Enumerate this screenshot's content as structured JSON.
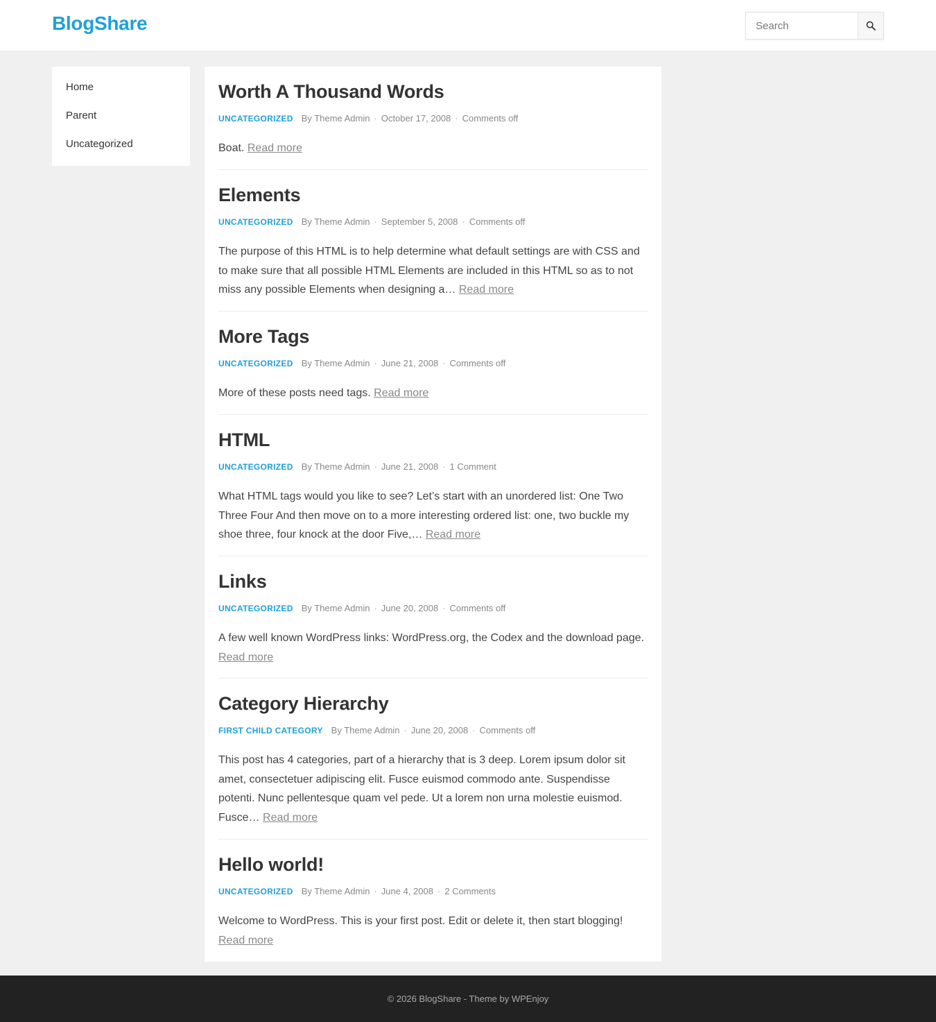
{
  "site": {
    "title": "BlogShare"
  },
  "search": {
    "placeholder": "Search"
  },
  "sidebar": {
    "items": [
      {
        "label": "Home"
      },
      {
        "label": "Parent"
      },
      {
        "label": "Uncategorized"
      }
    ]
  },
  "posts": [
    {
      "title": "Worth A Thousand Words",
      "category": "Uncategorized",
      "author": "By Theme Admin",
      "date": "October 17, 2008",
      "comments": "Comments off",
      "excerpt": "Boat.",
      "read_more": "Read more"
    },
    {
      "title": "Elements",
      "category": "Uncategorized",
      "author": "By Theme Admin",
      "date": "September 5, 2008",
      "comments": "Comments off",
      "excerpt": "The purpose of this HTML is to help determine what default settings are with CSS and to make sure that all possible HTML Elements are included in this HTML so as to not miss any possible Elements when designing a…",
      "read_more": "Read more"
    },
    {
      "title": "More Tags",
      "category": "Uncategorized",
      "author": "By Theme Admin",
      "date": "June 21, 2008",
      "comments": "Comments off",
      "excerpt": "More of these posts need tags.",
      "read_more": "Read more"
    },
    {
      "title": "HTML",
      "category": "Uncategorized",
      "author": "By Theme Admin",
      "date": "June 21, 2008",
      "comments": "1 Comment",
      "excerpt": "What HTML tags would you like to see? Let’s start with an unordered list: One Two Three Four And then move on to a more interesting ordered list: one, two buckle my shoe three, four knock at the door Five,…",
      "read_more": "Read more"
    },
    {
      "title": "Links",
      "category": "Uncategorized",
      "author": "By Theme Admin",
      "date": "June 20, 2008",
      "comments": "Comments off",
      "excerpt": "A few well known WordPress links: WordPress.org, the Codex and the download page.",
      "read_more": "Read more"
    },
    {
      "title": "Category Hierarchy",
      "category": "First Child Category",
      "author": "By Theme Admin",
      "date": "June 20, 2008",
      "comments": "Comments off",
      "excerpt": "This post has 4 categories, part of a hierarchy that is 3 deep. Lorem ipsum dolor sit amet, consectetuer adipiscing elit. Fusce euismod commodo ante. Suspendisse potenti. Nunc pellentesque quam vel pede. Ut a lorem non urna molestie euismod. Fusce…",
      "read_more": "Read more"
    },
    {
      "title": "Hello world!",
      "category": "Uncategorized",
      "author": "By Theme Admin",
      "date": "June 4, 2008",
      "comments": "2 Comments",
      "excerpt": "Welcome to WordPress. This is your first post. Edit or delete it, then start blogging!",
      "read_more": "Read more"
    }
  ],
  "footer": {
    "text": "© 2026 BlogShare - Theme by WPEnjoy"
  }
}
